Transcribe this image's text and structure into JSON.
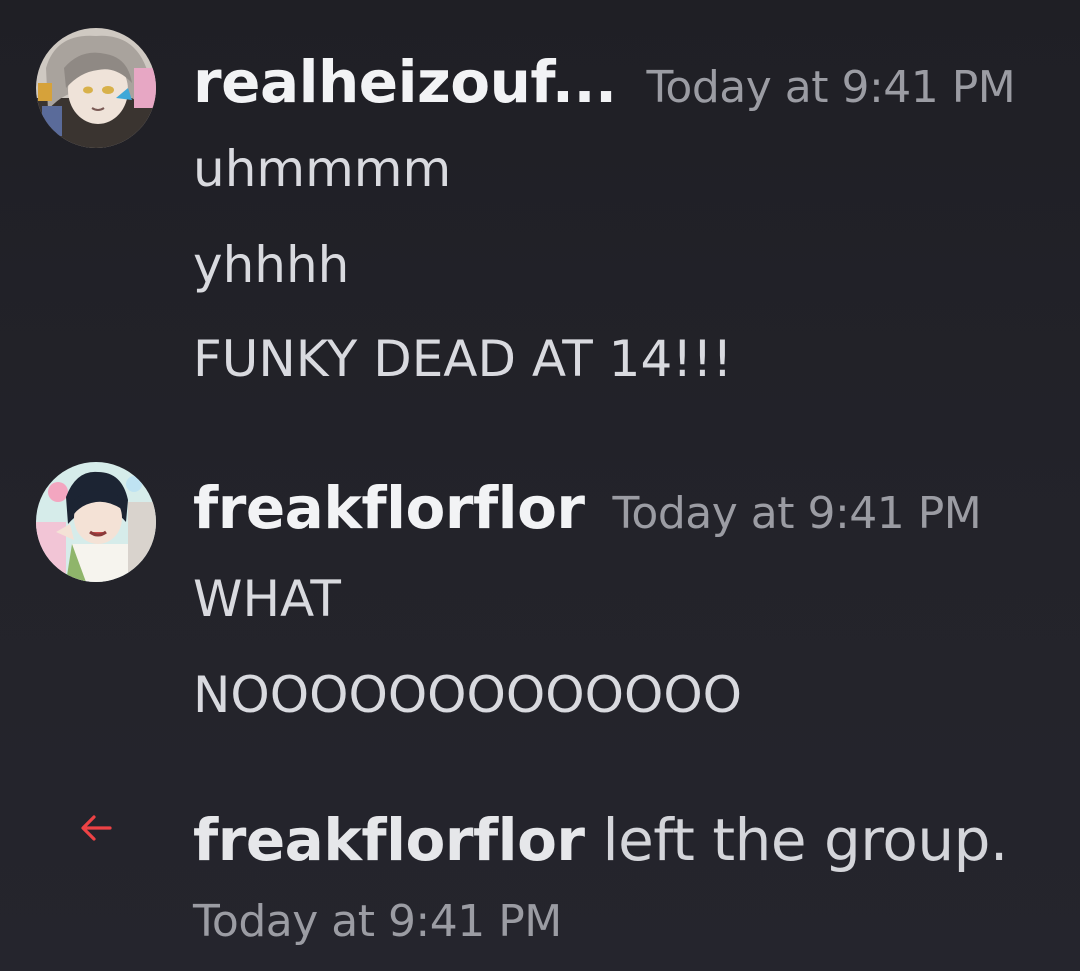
{
  "messages": [
    {
      "author": "realheizouf...",
      "timestamp": "Today at 9:41 PM",
      "avatar_icon": "avatar-realheizouf",
      "lines": [
        "uhmmmm",
        "yhhhh",
        "FUNKY DEAD AT 14!!!"
      ]
    },
    {
      "author": "freakflorflor",
      "timestamp": "Today at 9:41 PM",
      "avatar_icon": "avatar-freakflorflor",
      "lines": [
        "WHAT",
        "NOOOOOOOOOOOOO"
      ]
    }
  ],
  "system": {
    "icon": "arrow-left-icon",
    "icon_color": "#ed4245",
    "user": "freakflorflor",
    "text": " left the group.",
    "timestamp": "Today at 9:41 PM"
  },
  "colors": {
    "background": "#23232a",
    "username": "#f2f3f5",
    "timestamp": "#9b9ca3",
    "message": "#d9dadf"
  }
}
